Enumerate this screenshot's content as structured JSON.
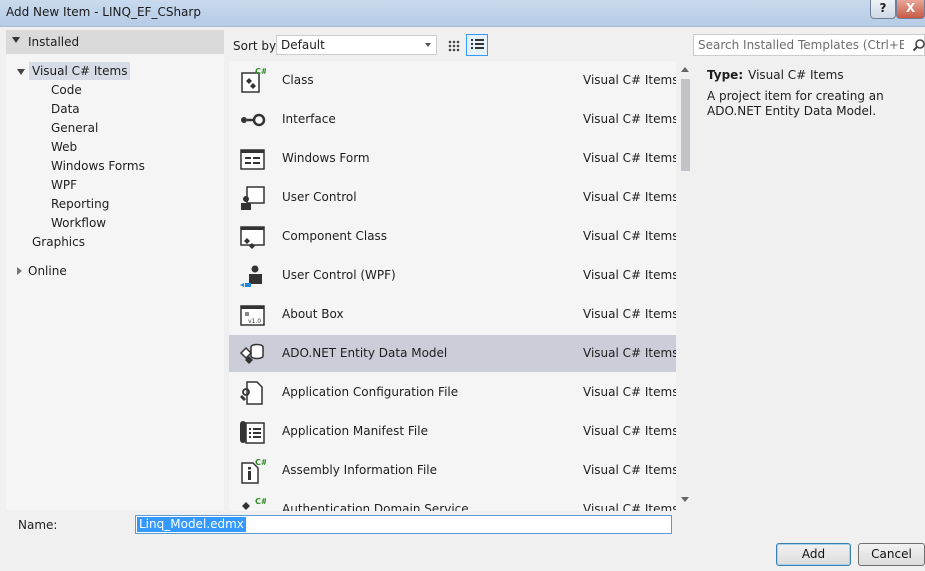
{
  "window": {
    "title": "Add New Item - LINQ_EF_CSharp",
    "help_label": "?",
    "close_label": "X"
  },
  "tree": {
    "installed_label": "Installed",
    "root_label": "Visual C# Items",
    "children": [
      "Code",
      "Data",
      "General",
      "Web",
      "Windows Forms",
      "WPF",
      "Reporting",
      "Workflow"
    ],
    "graphics_label": "Graphics",
    "online_label": "Online"
  },
  "sort": {
    "label": "Sort by:",
    "value": "Default"
  },
  "view": {
    "grid_icon": "small-icons-view-icon",
    "list_icon": "list-view-icon",
    "active": "list"
  },
  "search": {
    "placeholder": "Search Installed Templates (Ctrl+E)",
    "icon": "search-icon"
  },
  "templates": [
    {
      "name": "Class",
      "category": "Visual C# Items",
      "icon": "class-icon",
      "selected": false
    },
    {
      "name": "Interface",
      "category": "Visual C# Items",
      "icon": "interface-icon",
      "selected": false
    },
    {
      "name": "Windows Form",
      "category": "Visual C# Items",
      "icon": "windows-form-icon",
      "selected": false
    },
    {
      "name": "User Control",
      "category": "Visual C# Items",
      "icon": "user-control-icon",
      "selected": false
    },
    {
      "name": "Component Class",
      "category": "Visual C# Items",
      "icon": "component-class-icon",
      "selected": false
    },
    {
      "name": "User Control (WPF)",
      "category": "Visual C# Items",
      "icon": "wpf-user-control-icon",
      "selected": false
    },
    {
      "name": "About Box",
      "category": "Visual C# Items",
      "icon": "about-box-icon",
      "selected": false
    },
    {
      "name": "ADO.NET Entity Data Model",
      "category": "Visual C# Items",
      "icon": "entity-data-model-icon",
      "selected": true
    },
    {
      "name": "Application Configuration File",
      "category": "Visual C# Items",
      "icon": "config-file-icon",
      "selected": false
    },
    {
      "name": "Application Manifest File",
      "category": "Visual C# Items",
      "icon": "manifest-file-icon",
      "selected": false
    },
    {
      "name": "Assembly Information File",
      "category": "Visual C# Items",
      "icon": "assembly-info-icon",
      "selected": false
    },
    {
      "name": "Authentication Domain Service",
      "category": "Visual C# Items",
      "icon": "domain-service-icon",
      "selected": false
    }
  ],
  "details": {
    "type_label": "Type:",
    "type_value": "Visual C# Items",
    "description": "A project item for creating an ADO.NET Entity Data Model."
  },
  "name_field": {
    "label": "Name:",
    "value": "Linq_Model.edmx"
  },
  "buttons": {
    "add": "Add",
    "cancel": "Cancel"
  },
  "colors": {
    "selection": "#cbcdd9",
    "accent": "#3399ff",
    "csharp_badge": "#2e8b22"
  }
}
